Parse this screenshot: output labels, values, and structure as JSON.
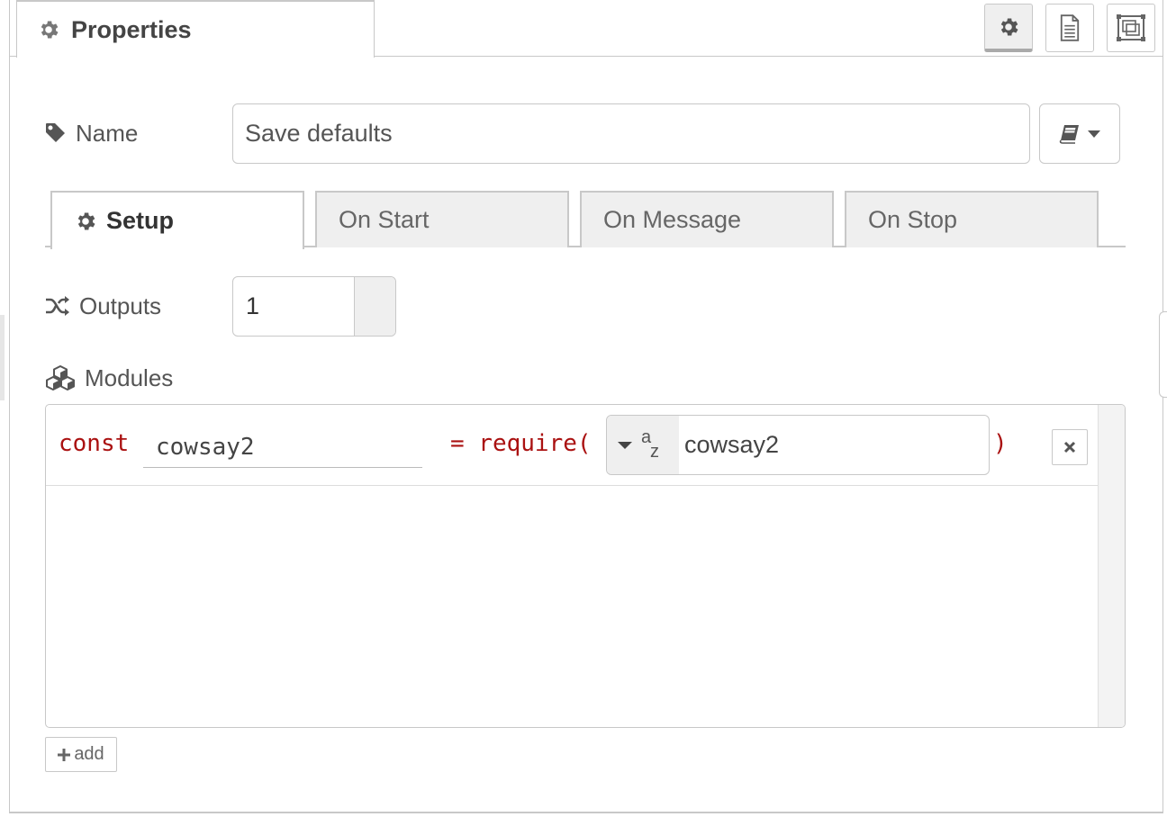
{
  "header": {
    "tab_label": "Properties",
    "buttons": [
      {
        "name": "settings",
        "icon": "gear-icon",
        "active": true
      },
      {
        "name": "description",
        "icon": "file-text-icon",
        "active": false
      },
      {
        "name": "appearance",
        "icon": "layout-icon",
        "active": false
      }
    ]
  },
  "form": {
    "name_label": "Name",
    "name_value": "Save defaults",
    "library_icon": "book-icon",
    "tabs": [
      {
        "label": "Setup",
        "icon": "gear-icon",
        "active": true
      },
      {
        "label": "On Start",
        "active": false
      },
      {
        "label": "On Message",
        "active": false
      },
      {
        "label": "On Stop",
        "active": false
      }
    ],
    "outputs_label": "Outputs",
    "outputs_value": "1",
    "modules_label": "Modules",
    "modules": [
      {
        "keyword": "const",
        "var_name": "cowsay2",
        "require_text": "= require(",
        "type_icon": "az-string-icon",
        "module_name": "cowsay2",
        "close_paren": ")"
      }
    ],
    "add_label": "add"
  },
  "colors": {
    "code_keyword": "#aa1111",
    "border": "#c8c8c8",
    "tab_inactive_bg": "#efefef"
  }
}
